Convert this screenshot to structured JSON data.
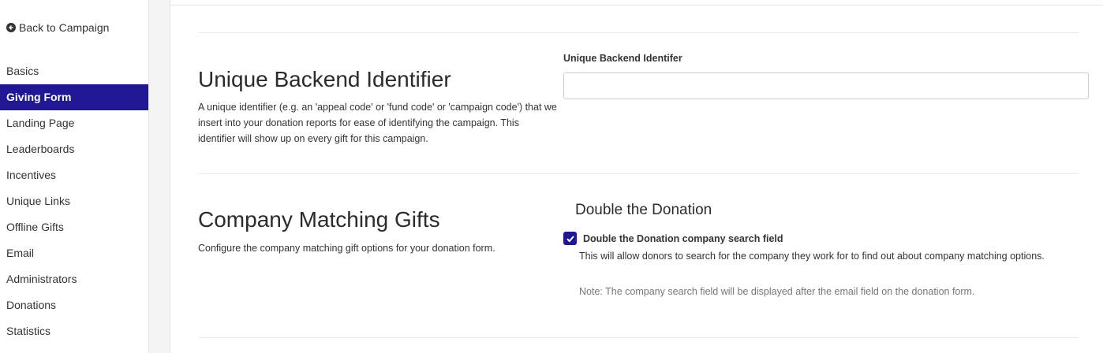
{
  "sidebar": {
    "back_label": "Back to Campaign",
    "back_icon": "arrow-circle-left-icon",
    "items": [
      {
        "label": "Basics",
        "active": false
      },
      {
        "label": "Giving Form",
        "active": true
      },
      {
        "label": "Landing Page",
        "active": false
      },
      {
        "label": "Leaderboards",
        "active": false
      },
      {
        "label": "Incentives",
        "active": false
      },
      {
        "label": "Unique Links",
        "active": false
      },
      {
        "label": "Offline Gifts",
        "active": false
      },
      {
        "label": "Email",
        "active": false
      },
      {
        "label": "Administrators",
        "active": false
      },
      {
        "label": "Donations",
        "active": false
      },
      {
        "label": "Statistics",
        "active": false
      }
    ]
  },
  "colors": {
    "accent": "#1f1793",
    "text": "#333333",
    "muted": "#777777"
  },
  "backend_identifier": {
    "title": "Unique Backend Identifier",
    "description": "A unique identifier (e.g. an 'appeal code' or 'fund code' or 'campaign code') that we insert into your donation reports for ease of identifying the campaign. This identifier will show up on every gift for this campaign.",
    "field_label": "Unique Backend Identifer",
    "field_value": "",
    "field_placeholder": ""
  },
  "matching_gifts": {
    "title": "Company Matching Gifts",
    "description": "Configure the company matching gift options for your donation form.",
    "subtitle": "Double the Donation",
    "checkbox_label": "Double the Donation company search field",
    "checkbox_checked": true,
    "help_text": "This will allow donors to search for the company they work for to find out about company matching options.",
    "note": "Note: The company search field will be displayed after the email field on the donation form."
  }
}
